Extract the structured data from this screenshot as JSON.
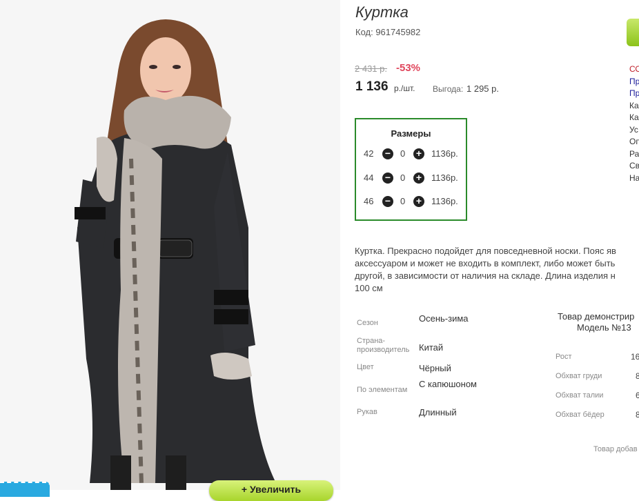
{
  "product": {
    "title": "Куртка",
    "code": "Код: 961745982",
    "old_price": "2 431 р.",
    "discount": "-53%",
    "price": "1 136",
    "unit": "р./шт.",
    "benefit_label": "Выгода:",
    "benefit": "1 295 р."
  },
  "sizes": {
    "title": "Размеры",
    "rows": [
      {
        "size": "42",
        "qty": "0",
        "price": "1136р."
      },
      {
        "size": "44",
        "qty": "0",
        "price": "1136р."
      },
      {
        "size": "46",
        "qty": "0",
        "price": "1136р."
      }
    ]
  },
  "description": [
    "Куртка. Прекрасно подойдет для повседневной носки. Пояс яв",
    "аксессуаром и может не входить в комплект, либо может быть",
    "другой, в зависимости от наличия на складе. Длина изделия н",
    "100 см"
  ],
  "attributes": [
    {
      "key": "Сезон",
      "value": "Осень-зима"
    },
    {
      "key": "Страна-производитель",
      "value": "Китай"
    },
    {
      "key": "Цвет",
      "value": "Чёрный"
    },
    {
      "key": "По элементам",
      "value": "С капюшоном"
    },
    {
      "key": "Рукав",
      "value": "Длинный"
    }
  ],
  "model": {
    "title_line1": "Товар демонстрир",
    "title_line2": "Модель №13",
    "params": [
      {
        "key": "Рост",
        "value": "16"
      },
      {
        "key": "Обхват груди",
        "value": "8"
      },
      {
        "key": "Обхват талии",
        "value": "6"
      },
      {
        "key": "Обхват бёдер",
        "value": "8"
      }
    ]
  },
  "added_note": "Товар добав",
  "zoom_button": "+ Увеличить",
  "right_menu": [
    "СО",
    "Пр",
    "Пр",
    "Ка",
    "Ка",
    "Ус",
    "Оп",
    "Ра",
    "Св",
    "На"
  ],
  "colors": {
    "accent_green": "#2a8a2a",
    "discount_red": "#e0465c",
    "button_green": "#a8d52c",
    "link_blue": "#1a1a9a",
    "badge_blue": "#29a9e0"
  },
  "icons": {
    "minus": "minus-circle-icon",
    "plus": "plus-circle-icon"
  }
}
